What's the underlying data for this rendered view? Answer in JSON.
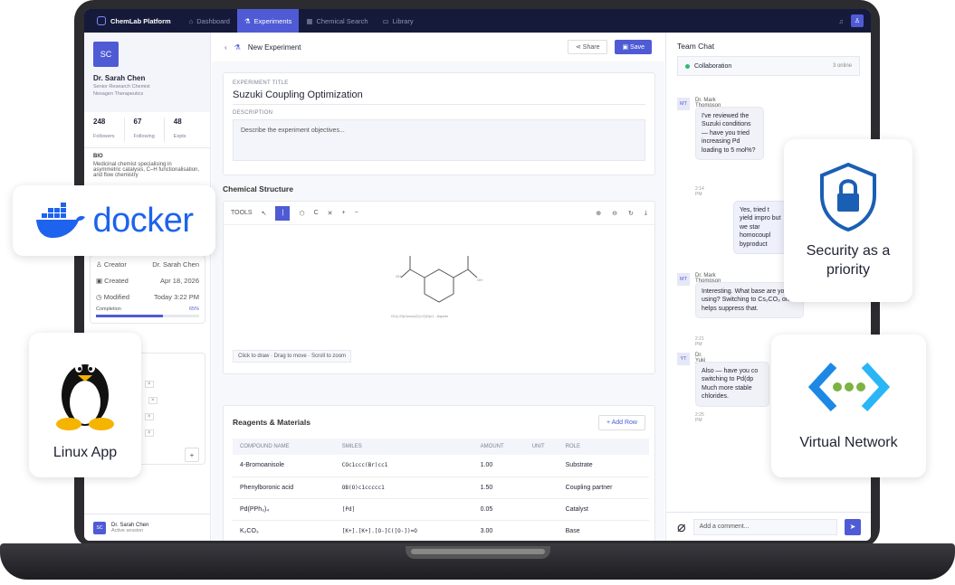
{
  "app": {
    "brand": "ChemLab Platform",
    "nav": [
      {
        "label": "Dashboard"
      },
      {
        "label": "Experiments"
      },
      {
        "label": "Chemical Search"
      },
      {
        "label": "Library"
      }
    ]
  },
  "profile": {
    "initials": "SC",
    "name": "Dr. Sarah Chen",
    "role": "Senior Research Chemist",
    "org": "Nexagen Therapeutics",
    "stats": [
      {
        "value": "248",
        "label": "Followers"
      },
      {
        "value": "67",
        "label": "Following"
      },
      {
        "value": "48",
        "label": "Expts"
      }
    ],
    "bio_label": "BIO",
    "bio": "Medicinal chemist specialising in asymmetric catalysis, C–H functionalisation, and flow chemistry"
  },
  "meta": {
    "creator_label": "Creator",
    "creator": "Dr. Sarah Chen",
    "created_label": "Created",
    "created": "Apr 18, 2026",
    "modified_label": "Modified",
    "modified": "Today 3:22 PM",
    "completion_label": "Completion",
    "completion": "65%",
    "completion_value": 0.65
  },
  "session": {
    "initials": "SC",
    "name": "Dr. Sarah Chen",
    "status": "Active session"
  },
  "header": {
    "breadcrumb": "New Experiment",
    "share": "Share",
    "save": "Save"
  },
  "experiment": {
    "title_label": "EXPERIMENT TITLE",
    "title": "Suzuki Coupling Optimization",
    "desc_label": "DESCRIPTION",
    "desc_placeholder": "Describe the experiment objectives..."
  },
  "structure": {
    "section": "Chemical Structure",
    "tools_label": "TOOLS",
    "caption": "OC(=O)c1cccc(C(=O)O)c1 - Aspirin",
    "hint": "Click to draw · Drag to move · Scroll to zoom"
  },
  "reagents": {
    "section": "Reagents & Materials",
    "add": "+ Add Row",
    "columns": [
      "COMPOUND NAME",
      "SMILES",
      "AMOUNT",
      "UNIT",
      "ROLE"
    ],
    "rows": [
      {
        "name": "4-Bromoanisole",
        "smiles": "COc1ccc(Br)cc1",
        "amount": "1.00",
        "unit": "",
        "role": "Substrate"
      },
      {
        "name": "Phenylboronic acid",
        "smiles": "OB(O)c1ccccc1",
        "amount": "1.50",
        "unit": "",
        "role": "Coupling partner"
      },
      {
        "name": "Pd(PPh₃)₄",
        "smiles": "[Pd]",
        "amount": "0.05",
        "unit": "",
        "role": "Catalyst"
      },
      {
        "name": "K₂CO₃",
        "smiles": "[K+].[K+].[O-]C([O-])=O",
        "amount": "3.00",
        "unit": "",
        "role": "Base"
      }
    ]
  },
  "chat": {
    "title": "Team Chat",
    "room": "Collaboration",
    "online": "3 online",
    "m1": {
      "initials": "MT",
      "name": "Dr. Mark Thompson",
      "text": "I've reviewed the Suzuki conditions — have you tried increasing Pd loading to 5 mol%?",
      "time": "2:14 PM"
    },
    "r1": "Yes, tried t yield impro but we star homocoupl byproduct",
    "m2": {
      "initials": "MT",
      "name": "Dr. Mark Thompson",
      "text": "Interesting. What base are you using? Switching to Cs₂CO₃ often helps suppress that.",
      "time": "2:21 PM"
    },
    "m3": {
      "initials": "YT",
      "name": "Dr. Yuki Tanaka",
      "text": "Also — have you co switching to Pd(dp Much more stable chlorides.",
      "time": "2:25 PM"
    },
    "placeholder": "Add a comment..."
  },
  "badges": {
    "docker": "docker",
    "security": "Security as a priority",
    "linux": "Linux App",
    "vnet": "Virtual Network"
  }
}
